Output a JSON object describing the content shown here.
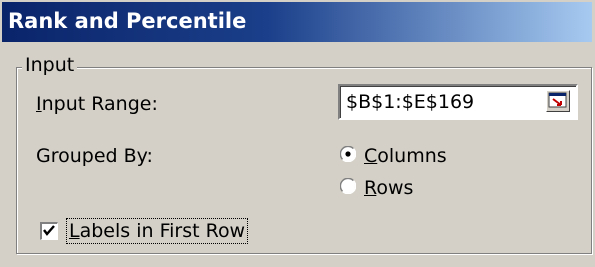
{
  "window": {
    "title": "Rank and Percentile"
  },
  "input_group": {
    "legend": "Input",
    "input_range": {
      "label_mnemonic": "I",
      "label_rest": "nput Range:",
      "value": "$B$1:$E$169"
    },
    "grouped_by": {
      "label": "Grouped By:",
      "options": [
        {
          "mnemonic": "C",
          "rest": "olumns",
          "selected": true
        },
        {
          "mnemonic": "R",
          "rest": "ows",
          "selected": false
        }
      ]
    },
    "labels_in_first_row": {
      "mnemonic": "L",
      "rest": "abels in First Row",
      "checked": true
    }
  },
  "colors": {
    "title_start": "#0a246a",
    "title_end": "#a6caf0",
    "dialog_bg": "#d4d0c8"
  }
}
